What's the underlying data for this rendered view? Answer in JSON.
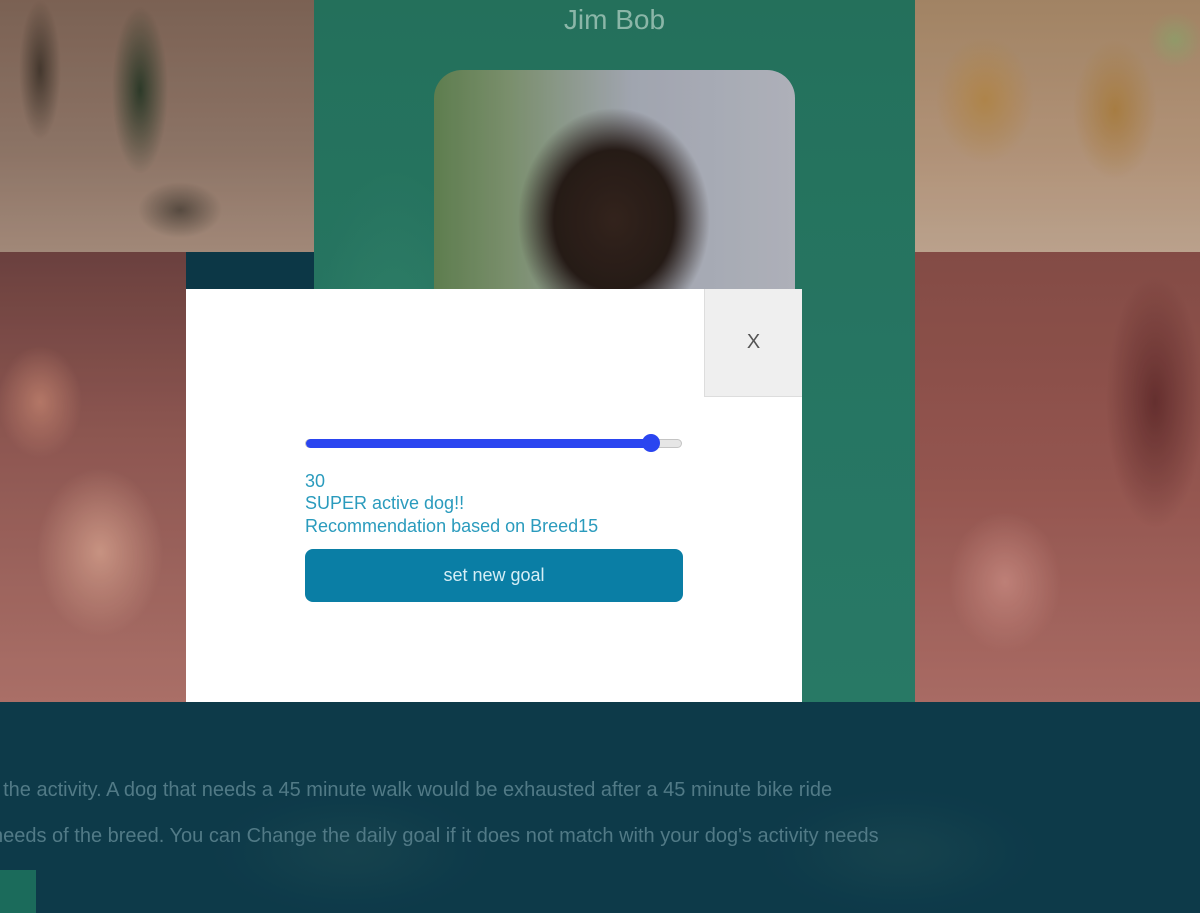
{
  "profile": {
    "owner_name": "Jim Bob"
  },
  "background_text": {
    "line1": "f the activity. A dog that needs a 45 minute walk would be exhausted after a 45 minute bike ride",
    "line2": "needs of the breed. You can Change the daily goal if it does not match with your dog's activity needs"
  },
  "modal": {
    "close_label": "X",
    "slider": {
      "value": 30,
      "fill_fraction": 0.92
    },
    "goal_value": "30",
    "activity_label": "SUPER active dog!!",
    "recommendation": "Recommendation based on Breed15",
    "set_goal_label": "set new goal"
  },
  "colors": {
    "accent": "#2a45f0",
    "button": "#0a7ea5",
    "text_accent": "#2a9bbd"
  }
}
